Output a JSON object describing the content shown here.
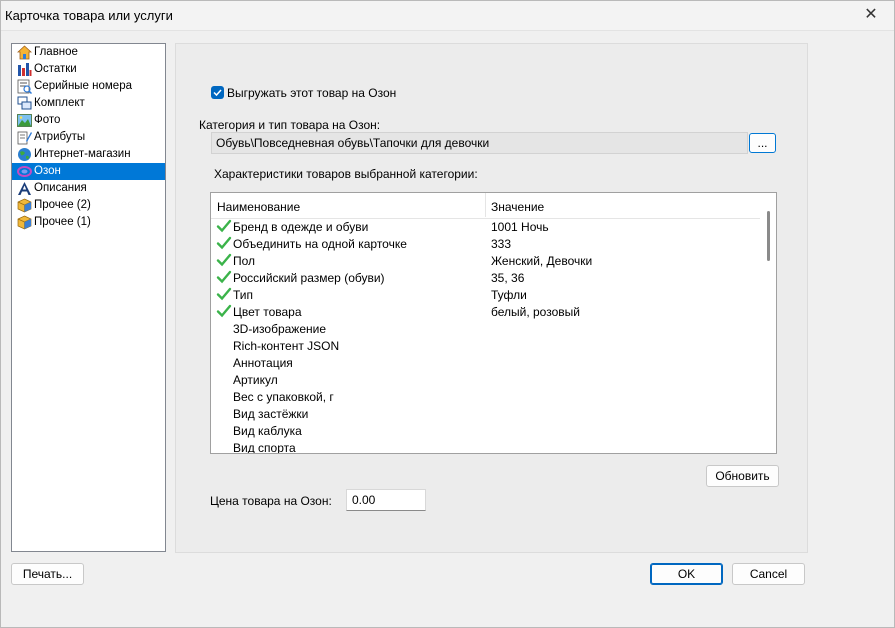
{
  "window": {
    "title": "Карточка товара или услуги",
    "close_glyph": "✕"
  },
  "nav": {
    "items": [
      {
        "label": "Главное",
        "icon": "home-icon"
      },
      {
        "label": "Остатки",
        "icon": "stock-bars-icon"
      },
      {
        "label": "Серийные номера",
        "icon": "serial-numbers-icon"
      },
      {
        "label": "Комплект",
        "icon": "kit-icon"
      },
      {
        "label": "Фото",
        "icon": "photo-icon"
      },
      {
        "label": "Атрибуты",
        "icon": "attributes-icon"
      },
      {
        "label": "Интернет-магазин",
        "icon": "globe-icon"
      },
      {
        "label": "Озон",
        "icon": "ozon-icon",
        "selected": true
      },
      {
        "label": "Описания",
        "icon": "text-a-icon"
      },
      {
        "label": "Прочее (2)",
        "icon": "box-icon"
      },
      {
        "label": "Прочее (1)",
        "icon": "box-icon"
      }
    ]
  },
  "ozon": {
    "export_checkbox": {
      "label": "Выгружать этот товар на Озон",
      "checked": true
    },
    "category_label": "Категория и тип товара на Озон:",
    "category_path": "Обувь\\Повседневная обувь\\Тапочки для девочки",
    "browse_label": "...",
    "characteristics_label": "Характеристики товаров выбранной категории:",
    "table": {
      "headers": [
        "Наименование",
        "Значение"
      ],
      "rows": [
        {
          "name": "Бренд в одежде и обуви",
          "value": "1001 Ночь",
          "filled": true
        },
        {
          "name": "Объединить на одной карточке",
          "value": "333",
          "filled": true
        },
        {
          "name": "Пол",
          "value": "Женский, Девочки",
          "filled": true
        },
        {
          "name": "Российский размер (обуви)",
          "value": "35, 36",
          "filled": true
        },
        {
          "name": "Тип",
          "value": "Туфли",
          "filled": true
        },
        {
          "name": "Цвет товара",
          "value": "белый, розовый",
          "filled": true
        },
        {
          "name": "3D-изображение",
          "value": "",
          "filled": false
        },
        {
          "name": "Rich-контент JSON",
          "value": "",
          "filled": false
        },
        {
          "name": "Аннотация",
          "value": "",
          "filled": false
        },
        {
          "name": "Артикул",
          "value": "",
          "filled": false
        },
        {
          "name": "Вес с упаковкой, г",
          "value": "",
          "filled": false
        },
        {
          "name": "Вид застёжки",
          "value": "",
          "filled": false
        },
        {
          "name": "Вид каблука",
          "value": "",
          "filled": false
        },
        {
          "name": "Вид спорта",
          "value": "",
          "filled": false
        }
      ]
    },
    "refresh_label": "Обновить",
    "price_label": "Цена товара на Озон:",
    "price_value": "0.00"
  },
  "footer": {
    "print_label": "Печать...",
    "ok_label": "OK",
    "cancel_label": "Cancel"
  },
  "colors": {
    "accent": "#0078d7",
    "check_green": "#3bb34a"
  }
}
